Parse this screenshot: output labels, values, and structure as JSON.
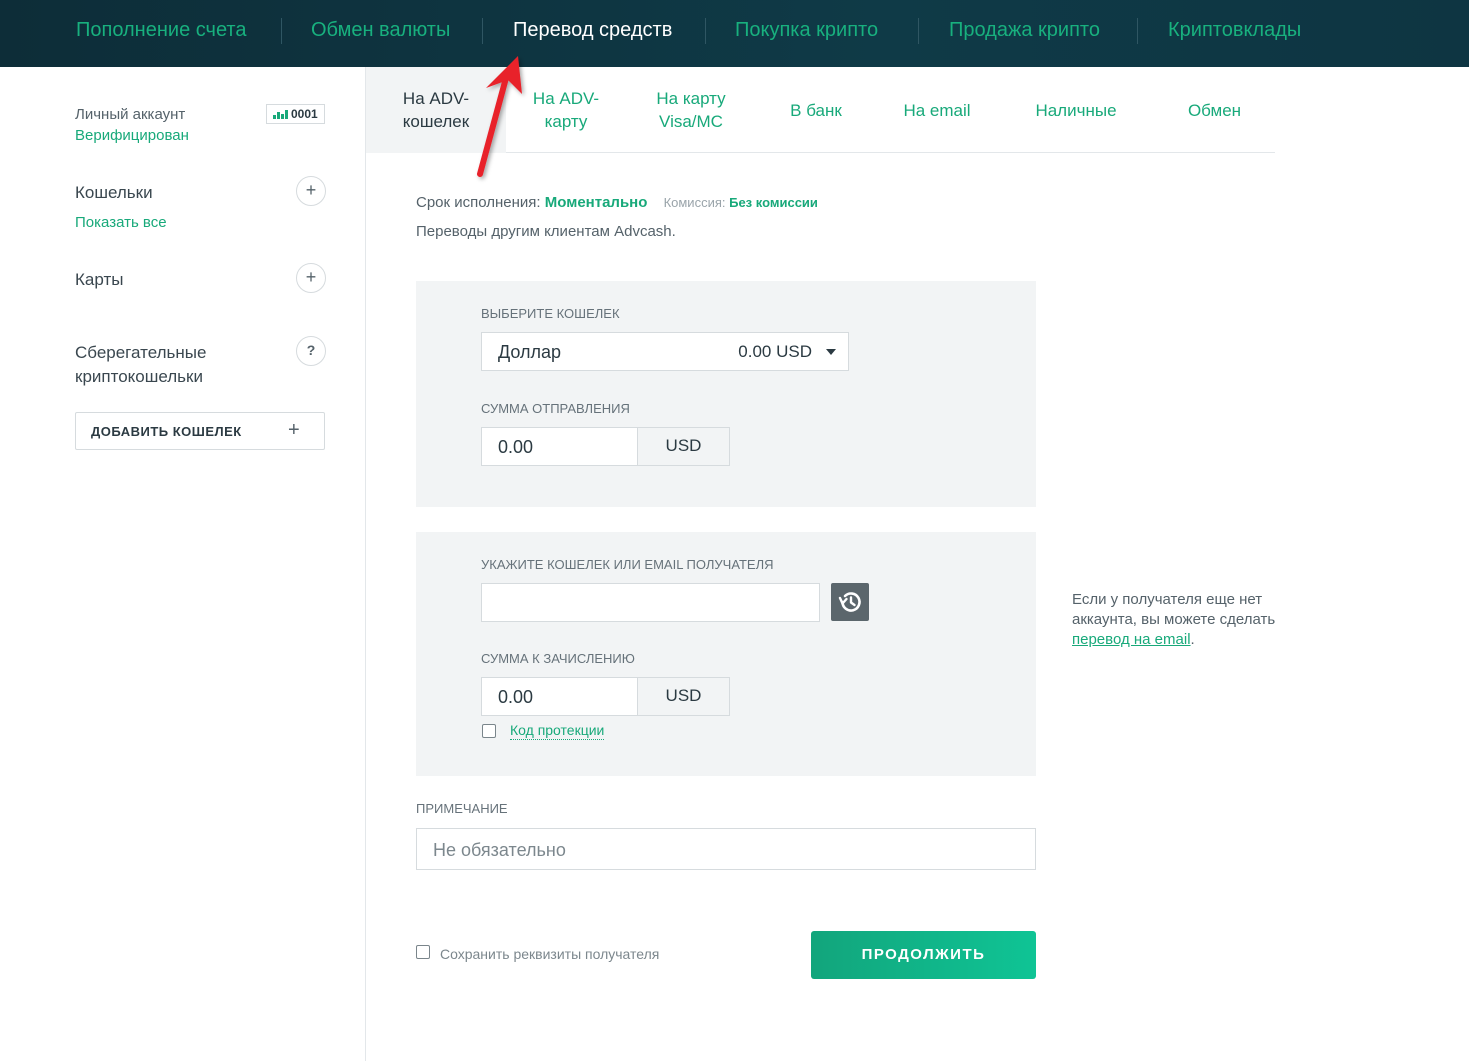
{
  "top_nav": {
    "items": [
      {
        "label": "Пополнение счета",
        "active": false
      },
      {
        "label": "Обмен валюты",
        "active": false
      },
      {
        "label": "Перевод средств",
        "active": true
      },
      {
        "label": "Покупка крипто",
        "active": false
      },
      {
        "label": "Продажа крипто",
        "active": false
      },
      {
        "label": "Криптовклады",
        "active": false
      }
    ]
  },
  "sidebar": {
    "account_label": "Личный аккаунт",
    "account_status": "Верифицирован",
    "account_number": "0001",
    "wallets_title": "Кошельки",
    "wallets_show_all": "Показать все",
    "cards_title": "Карты",
    "savings_title_line1": "Сберегательные",
    "savings_title_line2": "криптокошельки",
    "savings_help": "?",
    "add_wallet_label": "ДОБАВИТЬ КОШЕЛЕК",
    "plus": "+"
  },
  "sub_tabs": [
    {
      "line1": "На ADV-",
      "line2": "кошелек",
      "active": true
    },
    {
      "line1": "На ADV-",
      "line2": "карту",
      "active": false
    },
    {
      "line1": "На карту",
      "line2": "Visa/MC",
      "active": false
    },
    {
      "line1": "В банк",
      "line2": "",
      "active": false
    },
    {
      "line1": "На email",
      "line2": "",
      "active": false
    },
    {
      "line1": "Наличные",
      "line2": "",
      "active": false
    },
    {
      "line1": "Обмен",
      "line2": "",
      "active": false
    }
  ],
  "info": {
    "term_label": "Срок исполнения:",
    "term_value": "Моментально",
    "fee_label": "Комиссия:",
    "fee_value": "Без комиссии",
    "description": "Переводы другим клиентам Advcash."
  },
  "send_panel": {
    "wallet_label": "ВЫБЕРИТЕ КОШЕЛЕК",
    "wallet_name": "Доллар",
    "wallet_balance": "0.00 USD",
    "amount_label": "СУММА ОТПРАВЛЕНИЯ",
    "amount_value": "0.00",
    "currency": "USD"
  },
  "receive_panel": {
    "recipient_label": "УКАЖИТЕ КОШЕЛЕК ИЛИ EMAIL ПОЛУЧАТЕЛЯ",
    "recipient_value": "",
    "credit_label": "СУММА К ЗАЧИСЛЕНИЮ",
    "credit_value": "0.00",
    "currency": "USD",
    "protection_code_label": "Код протекции",
    "protection_checked": false
  },
  "note": {
    "label": "ПРИМЕЧАНИЕ",
    "placeholder": "Не обязательно"
  },
  "save_recipient_label": "Сохранить реквизиты получателя",
  "continue_label": "ПРОДОЛЖИТЬ",
  "side_note": {
    "text_line1": "Если у получателя еще нет",
    "text_line2": "аккаунта, вы можете сделать",
    "link": "перевод на email",
    "tail": "."
  },
  "colors": {
    "accent_green": "#18a97a",
    "nav_bg": "#0e3440",
    "arrow_red": "#e8202a"
  }
}
